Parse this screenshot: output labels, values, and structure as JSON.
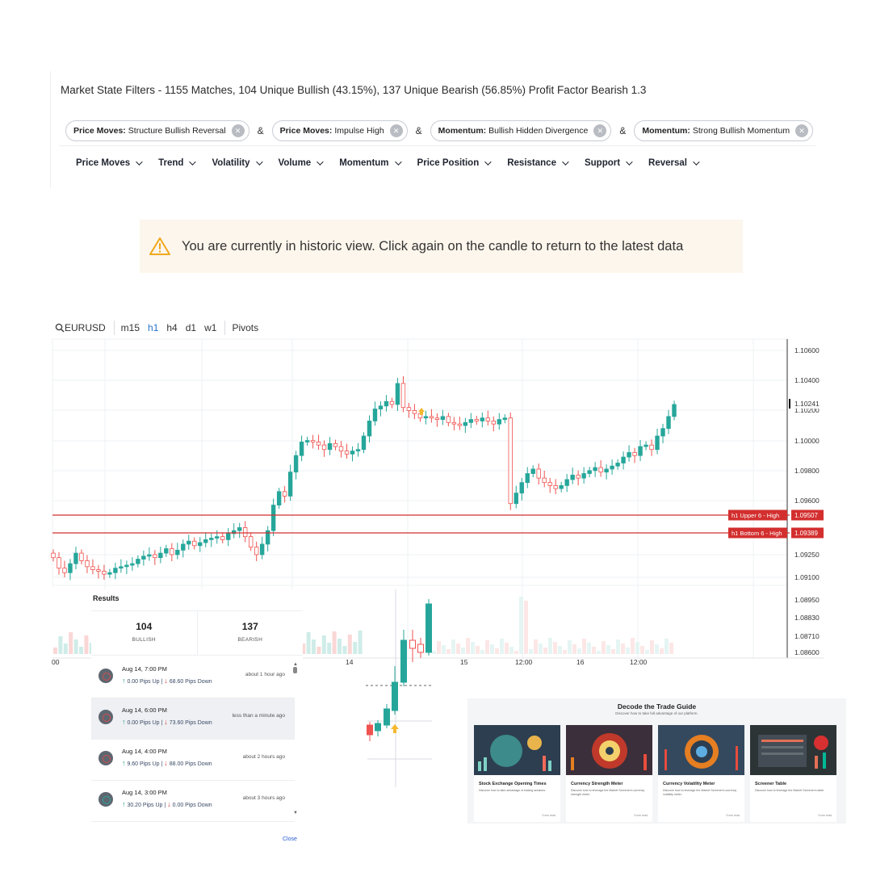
{
  "filters": {
    "summary": "Market State Filters - 1155 Matches, 104 Unique Bullish (43.15%), 137 Unique Bearish (56.85%) Profit Factor Bearish 1.3",
    "chips": [
      {
        "category": "Price Moves:",
        "value": "Structure Bullish Reversal"
      },
      {
        "category": "Price Moves:",
        "value": "Impulse High"
      },
      {
        "category": "Momentum:",
        "value": "Bullish Hidden Divergence"
      },
      {
        "category": "Momentum:",
        "value": "Strong Bullish Momentum"
      }
    ],
    "joiner": "&",
    "menu": [
      "Price Moves",
      "Trend",
      "Volatility",
      "Volume",
      "Momentum",
      "Price Position",
      "Resistance",
      "Support",
      "Reversal"
    ]
  },
  "banner": {
    "icon": "warning-triangle-icon",
    "text": "You are currently in historic view. Click again on the candle to return to the latest data",
    "background": "#fdf6ec",
    "icon_color": "#f0a81c"
  },
  "chart": {
    "symbol": "EURUSD",
    "timeframes": [
      "m15",
      "h1",
      "h4",
      "d1",
      "w1"
    ],
    "active_timeframe": "h1",
    "pivots_label": "Pivots",
    "bull_color": "#26a69a",
    "bear_color": "#ef5350",
    "level_color": "#d32f2f"
  },
  "chart_data": {
    "type": "candlestick",
    "title": "",
    "symbol": "EURUSD",
    "timeframe": "h1",
    "price_ticks": [
      "1.10600",
      "1.10400",
      "1.10200",
      "1.10000",
      "1.09800",
      "1.09600",
      "1.09250",
      "1.09100",
      "1.08950",
      "1.08830",
      "1.08710",
      "1.08600"
    ],
    "current_price": "1.10241",
    "x_ticks": [
      "14",
      "15",
      "12:00",
      "16",
      "12:00"
    ],
    "lower_x_tick": "00",
    "levels": [
      {
        "label": "h1 Upper 6 - High",
        "price": "1.09507"
      },
      {
        "label": "h1 Bottom 6 - High",
        "price": "1.09389"
      }
    ],
    "closes": [
      1.0922,
      1.0915,
      1.0912,
      1.0918,
      1.0925,
      1.092,
      1.0916,
      1.0914,
      1.0913,
      1.0911,
      1.0912,
      1.0915,
      1.0916,
      1.0917,
      1.0918,
      1.0921,
      1.0923,
      1.0924,
      1.0922,
      1.0925,
      1.0928,
      1.0924,
      1.0927,
      1.0931,
      1.0933,
      1.093,
      1.0932,
      1.0934,
      1.0935,
      1.0936,
      1.0934,
      1.0938,
      1.094,
      1.0942,
      1.0936,
      1.0929,
      1.0924,
      1.0931,
      1.094,
      1.0957,
      1.0966,
      1.0963,
      1.0979,
      1.099,
      1.0999,
      1.1,
      1.0999,
      1.0997,
      1.0994,
      1.0998,
      1.0996,
      1.0993,
      1.0991,
      1.0993,
      1.0994,
      1.1003,
      1.1013,
      1.1021,
      1.1023,
      1.1026,
      1.1024,
      1.1038,
      1.1022,
      1.102,
      1.1018,
      1.1015,
      1.1016,
      1.1015,
      1.1014,
      1.1016,
      1.1012,
      1.1011,
      1.101,
      1.1012,
      1.1014,
      1.1013,
      1.1015,
      1.1013,
      1.1011,
      1.1014,
      1.1015,
      1.0958,
      1.0965,
      1.0972,
      1.0978,
      1.0981,
      1.0975,
      1.0972,
      1.097,
      1.0968,
      1.097,
      1.0974,
      1.0977,
      1.0975,
      1.0978,
      1.098,
      1.0982,
      1.0979,
      1.0981,
      1.0983,
      1.0985,
      1.0989,
      1.0992,
      1.099,
      1.0996,
      1.0997,
      1.0994,
      1.1003,
      1.1008,
      1.1016,
      1.1024
    ]
  },
  "results": {
    "title": "Results",
    "bullish_count": "104",
    "bullish_label": "BULLISH",
    "bearish_count": "137",
    "bearish_label": "BEARISH",
    "items": [
      {
        "date": "Aug 14, 7:00 PM",
        "up": "0.00 Pips Up",
        "down": "68.60 Pips Down",
        "ago": "about 1 hour ago",
        "selected": false,
        "bull": false
      },
      {
        "date": "Aug 14, 6:00 PM",
        "up": "0.00 Pips Up",
        "down": "73.60 Pips Down",
        "ago": "less than a minute ago",
        "selected": true,
        "bull": false
      },
      {
        "date": "Aug 14, 4:00 PM",
        "up": "9.60 Pips Up",
        "down": "88.00 Pips Down",
        "ago": "about 2 hours ago",
        "selected": false,
        "bull": false
      },
      {
        "date": "Aug 14, 3:00 PM",
        "up": "30.20 Pips Up",
        "down": "0.00 Pips Down",
        "ago": "about 3 hours ago",
        "selected": false,
        "bull": true
      }
    ],
    "close_label": "Close"
  },
  "guide": {
    "title": "Decode the Trade Guide",
    "subtitle": "Discover how to take full advantage of our platform.",
    "cards": [
      {
        "title": "Stock Exchange Opening Times",
        "desc": "Discover how to take advantage of trading sessions.",
        "read": "5 min read",
        "accent": "#2e7d7a"
      },
      {
        "title": "Currency Strength Meter",
        "desc": "Discover how to leverage the Market Screener's currency strength meter.",
        "read": "5 min read",
        "accent": "#c0392b"
      },
      {
        "title": "Currency Volatility Meter",
        "desc": "Discover how to leverage the Market Screener's currency volatility meter.",
        "read": "5 min read",
        "accent": "#e67e22"
      },
      {
        "title": "Screener Table",
        "desc": "Discover how to leverage the Market Screener's table.",
        "read": "5 min read",
        "accent": "#d35400"
      }
    ]
  }
}
